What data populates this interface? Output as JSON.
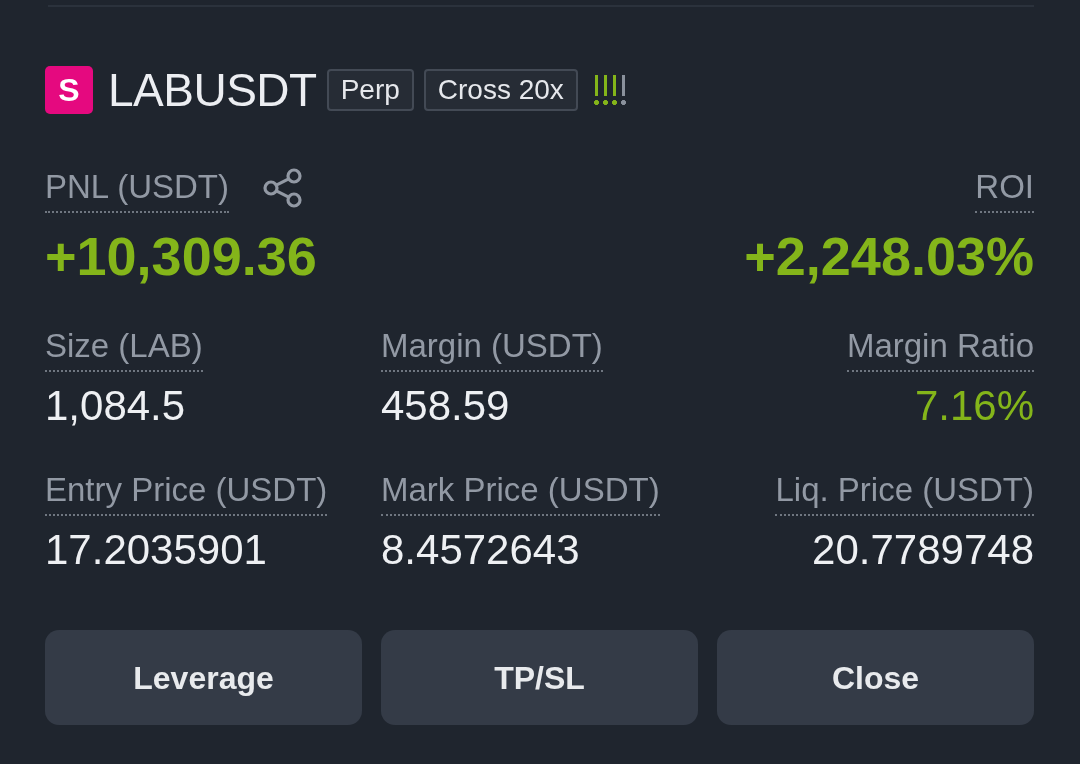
{
  "position": {
    "symbol_badge": "S",
    "symbol": "LABUSDT",
    "tags": [
      "Perp",
      "Cross 20x"
    ],
    "risk_meter": {
      "level": 0.75
    },
    "pnl": {
      "label": "PNL (USDT)",
      "value": "+10,309.36"
    },
    "roi": {
      "label": "ROI",
      "value": "+2,248.03%"
    },
    "fields": [
      {
        "label": "Size (LAB)",
        "value": "1,084.5",
        "positive": false
      },
      {
        "label": "Margin (USDT)",
        "value": "458.59",
        "positive": false
      },
      {
        "label": "Margin Ratio",
        "value": "7.16%",
        "positive": true
      },
      {
        "label": "Entry Price (USDT)",
        "value": "17.2035901",
        "positive": false
      },
      {
        "label": "Mark Price (USDT)",
        "value": "8.4572643",
        "positive": false
      },
      {
        "label": "Liq. Price (USDT)",
        "value": "20.7789748",
        "positive": false
      }
    ]
  },
  "buttons": [
    "Leverage",
    "TP/SL",
    "Close"
  ]
}
